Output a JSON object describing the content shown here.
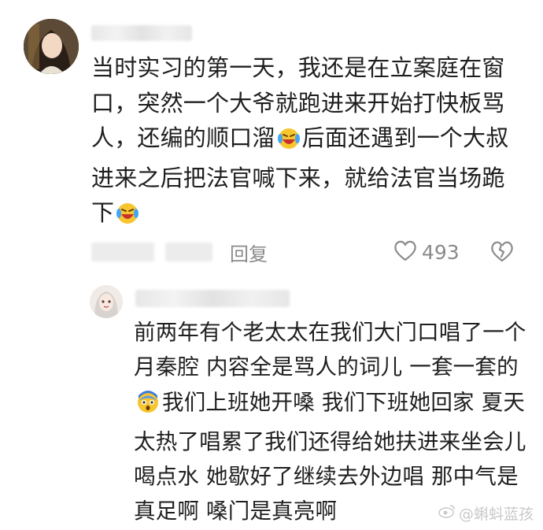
{
  "comment": {
    "text_lines": [
      "当时实习的第一天，我还是在立案庭在窗",
      "口，突然一个大爷就跑进来开始打快板骂",
      "人，还编的顺口溜",
      "后面还遇到一个大叔",
      "进来之后把法官喊下来，就给法官当场跪",
      "下"
    ],
    "emoji": "crying-laughing-icon"
  },
  "meta": {
    "reply_label": "回复",
    "like_count": "493"
  },
  "reply": {
    "text_lines": [
      "前两年有个老太太在我们大门口唱了一",
      "个月秦腔 内容全是骂人的词儿 一套一",
      "套的",
      "我们上班她开嗓 我们下班她回",
      "家 夏天太热了唱累了我们还得给她扶",
      "进来坐会儿喝点水 她歇好了继续去外",
      "边唱 那中气是真足啊 嗓门是真亮啊"
    ],
    "emoji": "shocked-face-icon"
  },
  "watermark": "@蝌蚪蓝孩"
}
